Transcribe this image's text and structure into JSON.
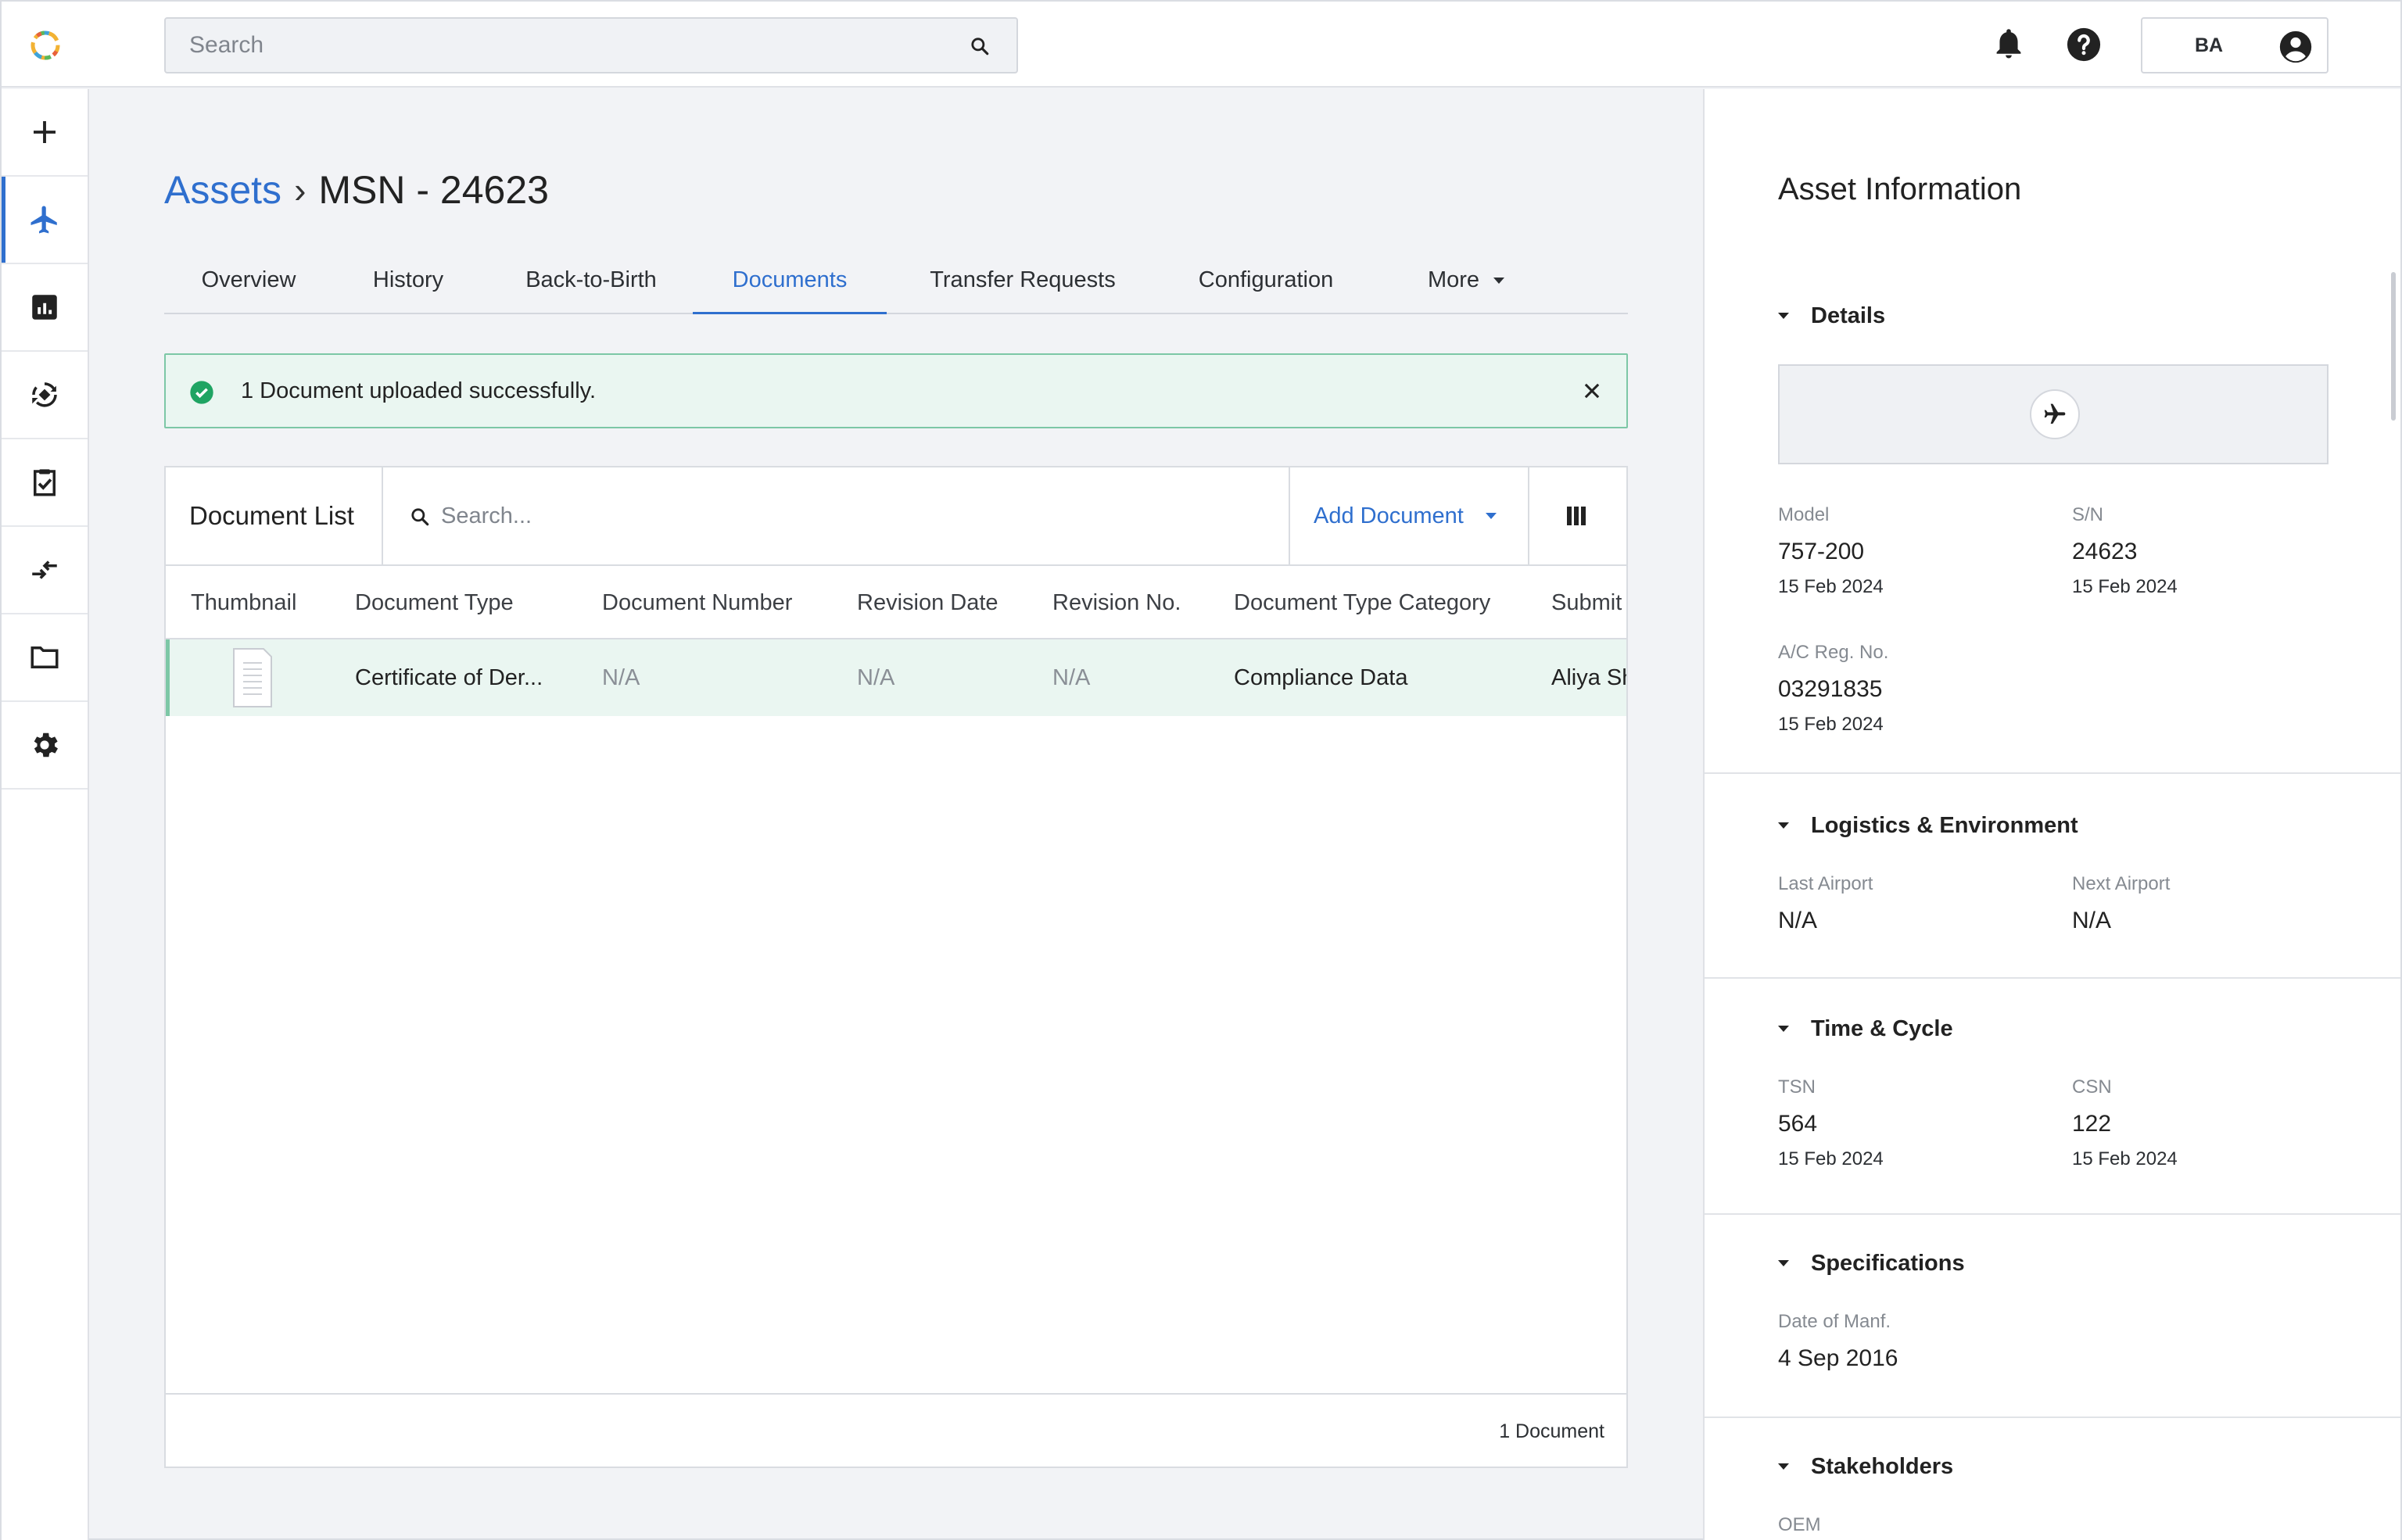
{
  "header": {
    "search_placeholder": "Search",
    "user_initials": "BA",
    "icons": [
      "app-logo-icon",
      "search-icon",
      "bell-icon",
      "help-icon",
      "account-icon"
    ]
  },
  "rail": {
    "items": [
      {
        "icon": "plus-icon",
        "active": false
      },
      {
        "icon": "airplane-icon",
        "active": true
      },
      {
        "icon": "chart-icon",
        "active": false
      },
      {
        "icon": "sync-parts-icon",
        "active": false
      },
      {
        "icon": "clipboard-check-icon",
        "active": false
      },
      {
        "icon": "transfer-icon",
        "active": false
      },
      {
        "icon": "folder-icon",
        "active": false
      },
      {
        "icon": "gear-icon",
        "active": false
      }
    ]
  },
  "breadcrumb": {
    "parent": "Assets",
    "separator": "›",
    "current": "MSN - 24623"
  },
  "tabs": [
    {
      "label": "Overview"
    },
    {
      "label": "History"
    },
    {
      "label": "Back-to-Birth"
    },
    {
      "label": "Documents",
      "active": true
    },
    {
      "label": "Transfer Requests"
    },
    {
      "label": "Configuration"
    },
    {
      "label": "More"
    }
  ],
  "alert": {
    "message": "1 Document uploaded successfully."
  },
  "documents": {
    "title": "Document List",
    "search_placeholder": "Search...",
    "add_label": "Add Document",
    "columns": [
      "Thumbnail",
      "Document Type",
      "Document Number",
      "Revision Date",
      "Revision No.",
      "Document Type Category",
      "Submit"
    ],
    "rows": [
      {
        "document_type": "Certificate of Der...",
        "document_number": "N/A",
        "revision_date": "N/A",
        "revision_no": "N/A",
        "category": "Compliance Data",
        "submitted_by": "Aliya Sh"
      }
    ],
    "footer_count": "1 Document"
  },
  "info": {
    "title": "Asset Information",
    "details": {
      "label": "Details",
      "model": {
        "label": "Model",
        "value": "757-200",
        "date": "15 Feb 2024"
      },
      "sn": {
        "label": "S/N",
        "value": "24623",
        "date": "15 Feb 2024"
      },
      "reg": {
        "label": "A/C Reg. No.",
        "value": "03291835",
        "date": "15 Feb 2024"
      }
    },
    "logistics": {
      "label": "Logistics & Environment",
      "last_airport": {
        "label": "Last Airport",
        "value": "N/A"
      },
      "next_airport": {
        "label": "Next Airport",
        "value": "N/A"
      }
    },
    "time_cycle": {
      "label": "Time & Cycle",
      "tsn": {
        "label": "TSN",
        "value": "564",
        "date": "15 Feb 2024"
      },
      "csn": {
        "label": "CSN",
        "value": "122",
        "date": "15 Feb 2024"
      }
    },
    "specifications": {
      "label": "Specifications",
      "manf": {
        "label": "Date of Manf.",
        "value": "4 Sep 2016"
      }
    },
    "stakeholders": {
      "label": "Stakeholders",
      "oem": {
        "label": "OEM"
      }
    }
  },
  "colors": {
    "accent": "#2f6fce",
    "success_bg": "#eaf6f1",
    "success_border": "#7dc7a6",
    "success_icon": "#1fa463"
  }
}
